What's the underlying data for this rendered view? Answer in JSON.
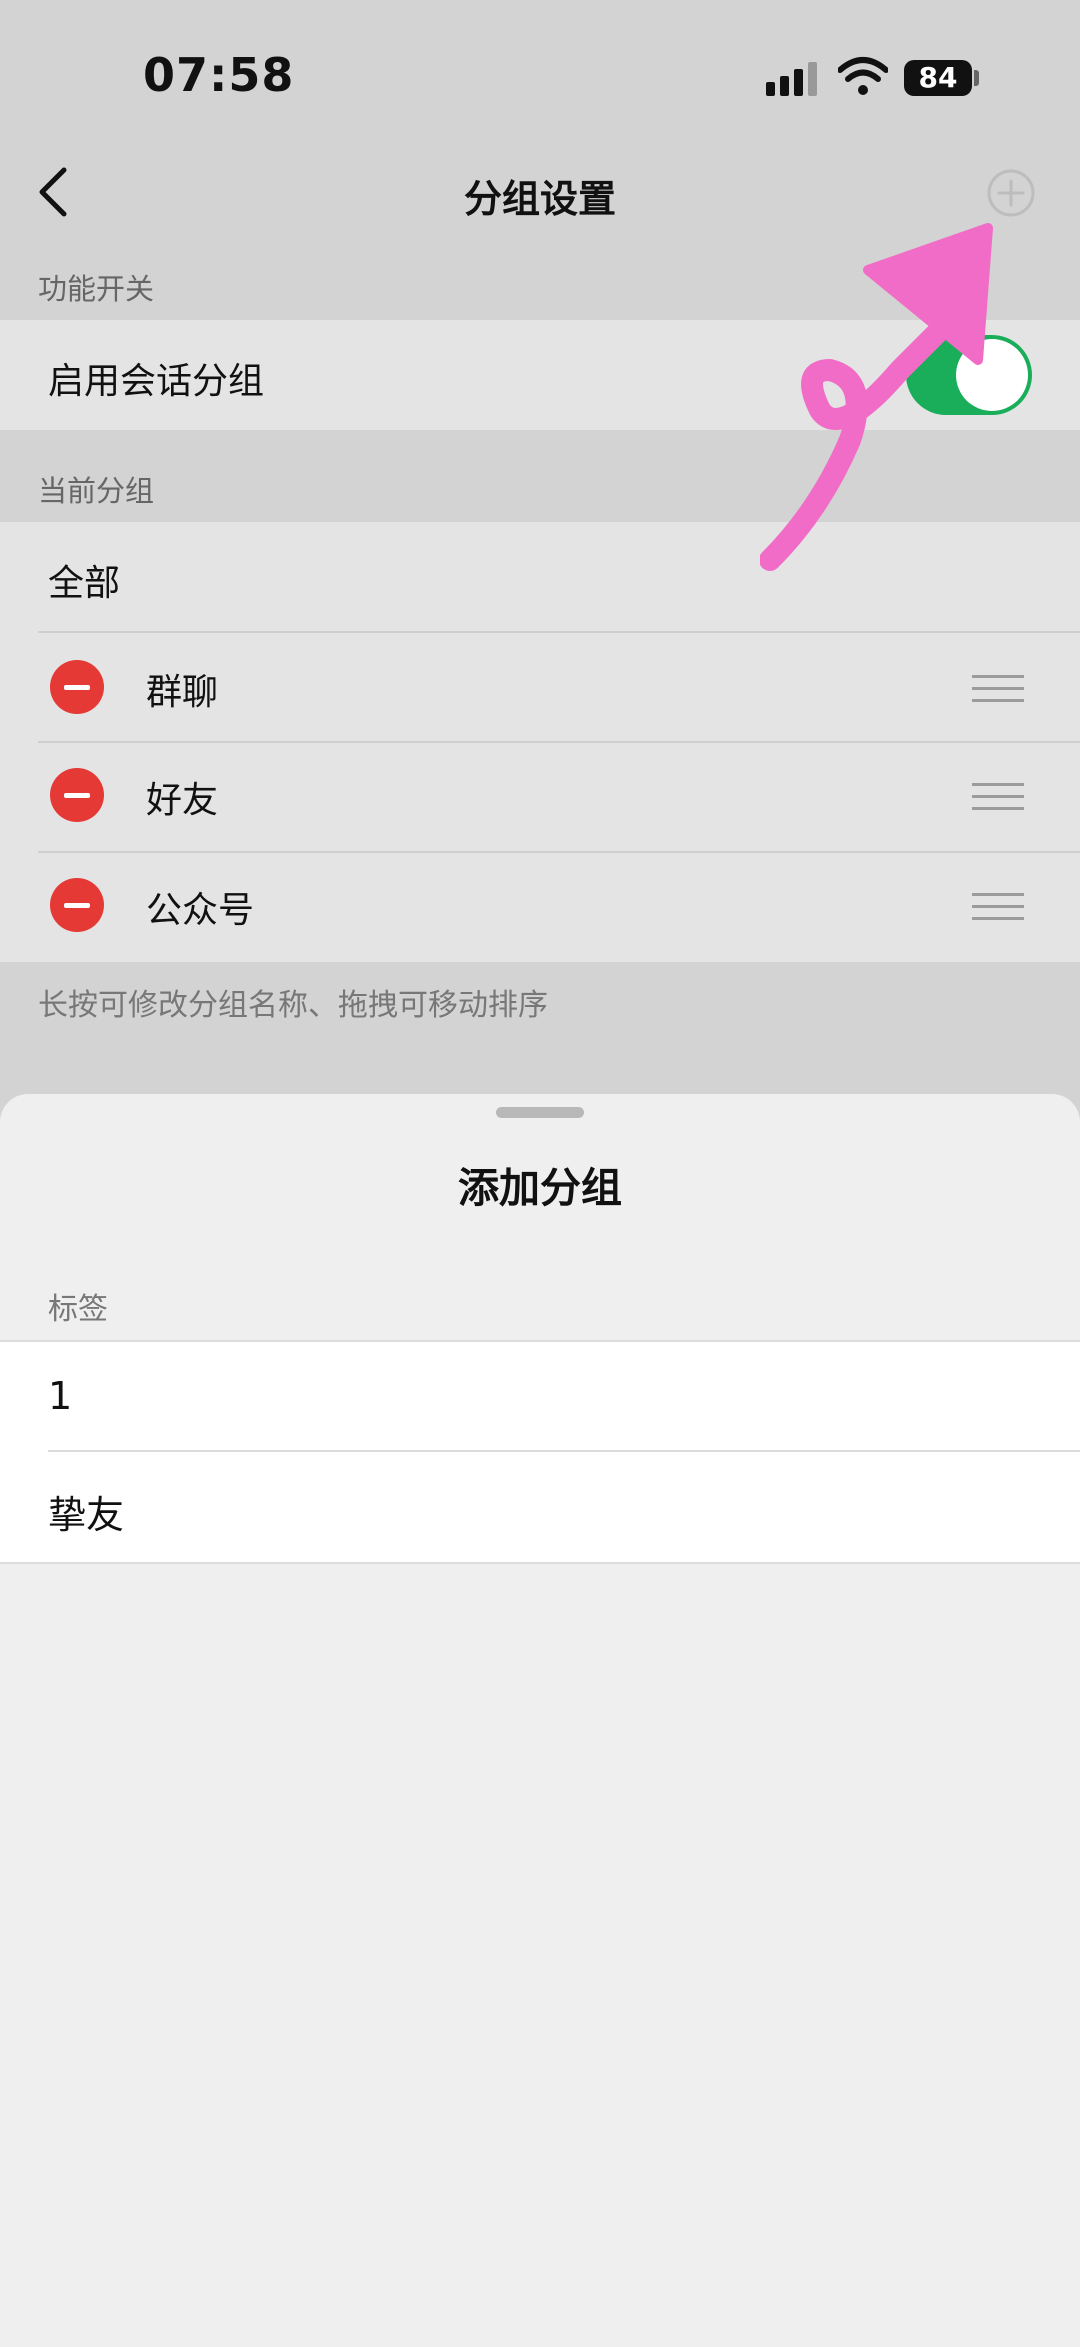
{
  "status_bar": {
    "time": "07:58",
    "battery": "84"
  },
  "nav": {
    "title": "分组设置"
  },
  "section_switch": {
    "label": "功能开关",
    "row_label": "启用会话分组",
    "toggle_on": true
  },
  "section_groups": {
    "label": "当前分组",
    "all_label": "全部",
    "items": [
      {
        "label": "群聊"
      },
      {
        "label": "好友"
      },
      {
        "label": "公众号"
      }
    ],
    "hint": "长按可修改分组名称、拖拽可移动排序"
  },
  "sheet": {
    "title": "添加分组",
    "section_label": "标签",
    "tags": [
      "1",
      "挚友"
    ]
  },
  "colors": {
    "toggle_green": "#1aad5a",
    "delete_red": "#e53935",
    "annotation_pink": "#f06cc6"
  },
  "icons": [
    "back-chevron-icon",
    "add-circle-icon",
    "delete-minus-icon",
    "drag-handle-icon",
    "signal-icon",
    "wifi-icon",
    "battery-icon"
  ]
}
